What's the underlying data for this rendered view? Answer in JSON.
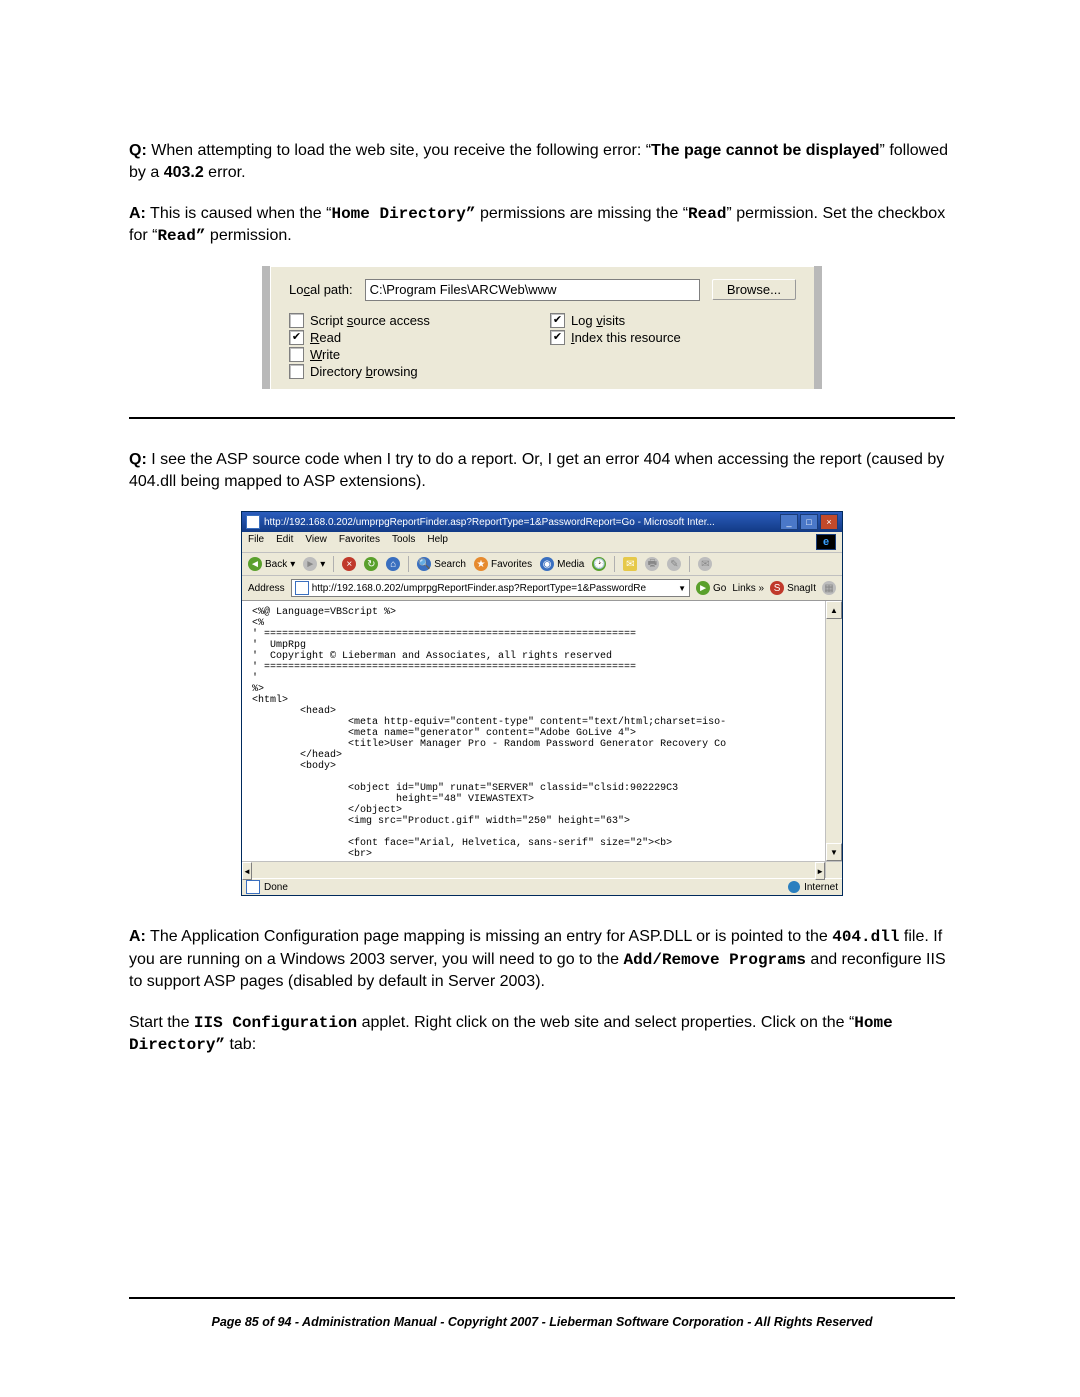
{
  "q1": {
    "prefix": "Q:",
    "text1": " When attempting to load the web site, you receive the following error: “",
    "err1": "The page cannot be displayed",
    "text2": "” followed by a ",
    "err2": "403.2",
    "text3": " error."
  },
  "a1": {
    "prefix": "A:",
    "t1": " This is caused when the “",
    "code1": "Home Directory”",
    "t2": " permissions are missing the “",
    "code2": "Read",
    "t3": "” permission.  Set the checkbox for “",
    "code3": "Read”",
    "t4": " permission."
  },
  "fig1": {
    "local_path_label": "Local path:",
    "local_path_value": "C:\\Program Files\\ARCWeb\\www",
    "browse": "Browse...",
    "left": [
      {
        "label": "Script source access",
        "u": "s",
        "checked": false
      },
      {
        "label": "Read",
        "u": "R",
        "checked": true
      },
      {
        "label": "Write",
        "u": "W",
        "checked": false
      },
      {
        "label": "Directory browsing",
        "u": "b",
        "checked": false
      }
    ],
    "right": [
      {
        "label": "Log visits",
        "u": "v",
        "checked": true
      },
      {
        "label": "Index this resource",
        "u": "I",
        "checked": true
      }
    ]
  },
  "q2": {
    "prefix": "Q:",
    "text": " I see the ASP source code when I try to do a report.  Or, I get an error 404 when accessing the report (caused by 404.dll being mapped to ASP extensions)."
  },
  "fig2": {
    "title": "http://192.168.0.202/umprpgReportFinder.asp?ReportType=1&PasswordReport=Go - Microsoft Inter...",
    "menus": [
      "File",
      "Edit",
      "View",
      "Favorites",
      "Tools",
      "Help"
    ],
    "toolbar": {
      "back": "Back",
      "search": "Search",
      "favorites": "Favorites",
      "media": "Media"
    },
    "address_label": "Address",
    "address_value": "http://192.168.0.202/umprpgReportFinder.asp?ReportType=1&PasswordRe",
    "go": "Go",
    "links": "Links",
    "snagit": "SnagIt",
    "status_done": "Done",
    "status_zone": "Internet",
    "src": "<%@ Language=VBScript %>\n<%\n' ==============================================================\n'  UmpRpg\n'  Copyright © Lieberman and Associates, all rights reserved\n' ==============================================================\n'\n%>\n<html>\n        <head>\n                <meta http-equiv=\"content-type\" content=\"text/html;charset=iso-\n                <meta name=\"generator\" content=\"Adobe GoLive 4\">\n                <title>User Manager Pro - Random Password Generator Recovery Co\n        </head>\n        <body>\n\n                <object id=\"Ump\" runat=\"SERVER\" classid=\"clsid:902229C3\n                        height=\"48\" VIEWASTEXT>\n                </object>\n                <img src=\"Product.gif\" width=\"250\" height=\"63\">\n\n                <font face=\"Arial, Helvetica, sans-serif\" size=\"2\"><b>\n                <br>"
  },
  "a2": {
    "prefix": "A:",
    "t1": " The Application Configuration page mapping is missing an entry for ASP.DLL or is pointed to the ",
    "code1": "404.dll",
    "t2": " file.  If you are running on a Windows 2003 server, you will need to go to the ",
    "code2": "Add/Remove Programs",
    "t3": " and reconfigure IIS to support ASP pages (disabled by default in Server 2003)."
  },
  "a2b": {
    "t1": "Start the ",
    "code1": "IIS Configuration",
    "t2": " applet.  Right click on the web site and select properties.  Click on the “",
    "code2": "Home Directory”",
    "t3": " tab:"
  },
  "footer": "Page 85 of 94 - Administration Manual - Copyright 2007 - Lieberman Software Corporation - All Rights Reserved"
}
